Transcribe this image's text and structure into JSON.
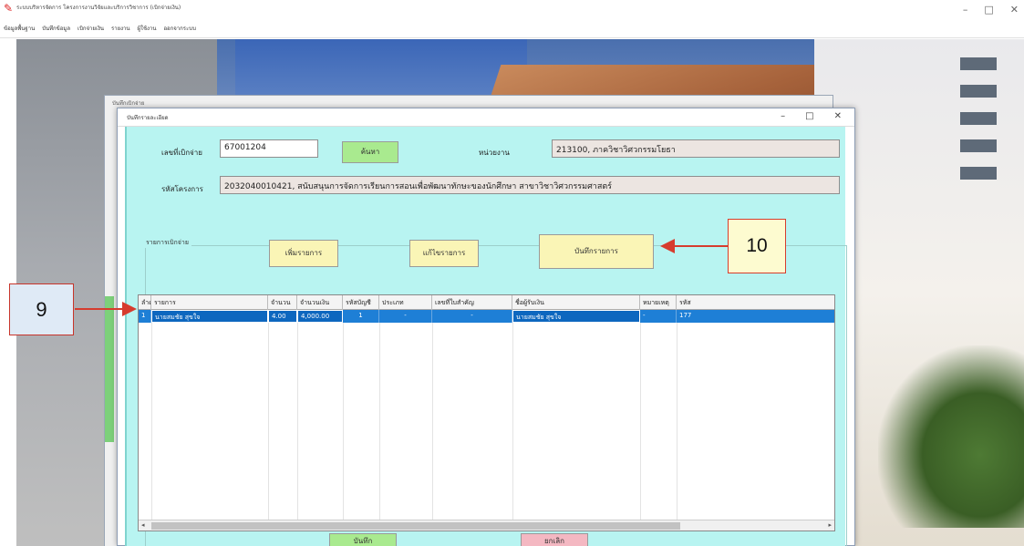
{
  "app": {
    "title": "ระบบบริหารจัดการ โครงการงานวิจัยและบริการวิชาการ (เบิกจ่ายเงิน)",
    "menu": [
      "ข้อมูลพื้นฐาน",
      "บันทึกข้อมูล",
      "เบิกจ่ายเงิน",
      "รายงาน",
      "ผู้ใช้งาน",
      "ออกจากระบบ"
    ],
    "window_controls": [
      "–",
      "□",
      "✕"
    ]
  },
  "outer_window": {
    "title": "บันทึกเบิกจ่าย"
  },
  "dialog": {
    "title": "บันทึกรายละเอียด",
    "window_controls": [
      "–",
      "□",
      "✕"
    ],
    "doc_number_label": "เลขที่เบิกจ่าย",
    "doc_number_value": "67001204",
    "search_button": "ค้นหา",
    "unit_label": "หน่วยงาน",
    "unit_value": "213100, ภาควิชาวิศวกรรมโยธา",
    "project_label": "รหัสโครงการ",
    "project_value": "2032040010421, สนับสนุนการจัดการเรียนการสอนเพื่อพัฒนาทักษะของนักศึกษา สาขาวิชาวิศวกรรมศาสตร์",
    "group_label": "รายการเบิกจ่าย",
    "btn_add": "เพิ่มรายการ",
    "btn_edit": "แก้ไขรายการ",
    "btn_save_line": "บันทึกรายการ",
    "btn_save": "บันทึก",
    "btn_cancel": "ยกเลิก"
  },
  "grid": {
    "columns": [
      "ลำดับ",
      "รายการ",
      "จำนวน",
      "จำนวนเงิน",
      "รหัสบัญชี",
      "ประเภท",
      "เลขที่ใบสำคัญ",
      "ชื่อผู้รับเงิน",
      "หมายเหตุ",
      "รหัส"
    ],
    "rows": [
      [
        "1",
        "นายสมชัย สุขใจ",
        "4.00",
        "4,000.00",
        "1",
        "-",
        "-",
        "นายสมชัย สุขใจ",
        "-",
        "177"
      ]
    ],
    "scroll_left": "◂",
    "scroll_right": "▸"
  },
  "annotations": {
    "callout_9": "9",
    "callout_10": "10",
    "accent": "#d63c2e"
  }
}
